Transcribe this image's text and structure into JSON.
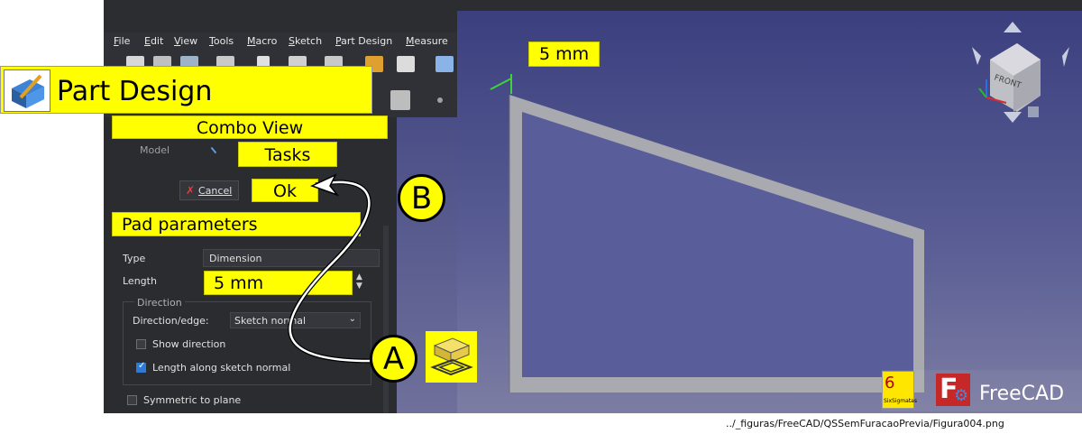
{
  "menu": [
    "File",
    "Edit",
    "View",
    "Tools",
    "Macro",
    "Sketch",
    "Part Design",
    "Measure"
  ],
  "workbench_label": "Part Design",
  "combo_view_label": "Combo View",
  "tabs": {
    "model": "Model",
    "tasks": "Tasks"
  },
  "buttons": {
    "cancel": "Cancel",
    "ok": "Ok"
  },
  "pad_parameters_title": "Pad parameters",
  "type": {
    "label": "Type",
    "value": "Dimension"
  },
  "length": {
    "label": "Length",
    "value": "5 mm"
  },
  "direction": {
    "group": "Direction",
    "edge_label": "Direction/edge:",
    "edge_value": "Sketch normal",
    "show_direction": "Show direction",
    "length_along_normal": "Length along sketch normal"
  },
  "symmetric_to_plane": "Symmetric to plane",
  "markers": {
    "a": "A",
    "b": "B"
  },
  "viewport": {
    "dimension_label": "5 mm",
    "navcube_face": "FRONT"
  },
  "branding": {
    "freecad": "FreeCAD",
    "sixsigmatas": "SixSigmatas"
  },
  "caption": "../_figuras/FreeCAD/QSSemFuracaoPrevia/Figura004.png"
}
